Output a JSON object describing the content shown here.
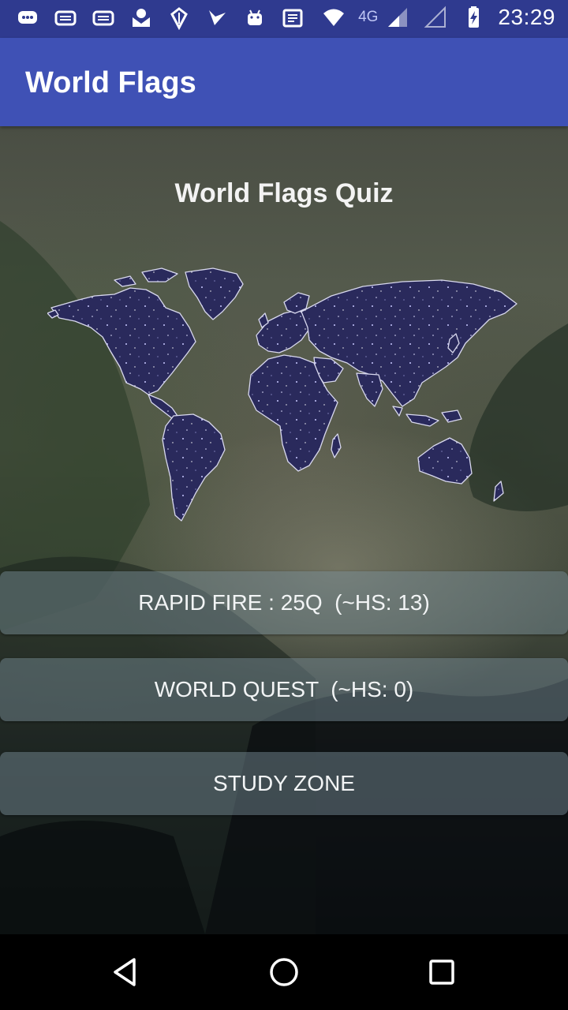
{
  "status_bar": {
    "left_icons": [
      "chat-icon",
      "mail-icon",
      "mail-icon",
      "envelope-icon",
      "game-icon",
      "checkmark-app-icon",
      "android-icon",
      "news-icon"
    ],
    "network_label": "4G",
    "right_icons": [
      "wifi-icon",
      "signal-icon",
      "signal-icon",
      "battery-charging-icon"
    ],
    "time": "23:29"
  },
  "app_bar": {
    "title": "World Flags",
    "color": "#3f51b5"
  },
  "main": {
    "quiz_title": "World Flags Quiz",
    "map_icon": "world-map-icon",
    "buttons": {
      "rapid_fire": "RAPID FIRE : 25Q  (~HS: 13)",
      "world_quest": "WORLD QUEST  (~HS: 0)",
      "study_zone": "STUDY ZONE"
    }
  },
  "nav_bar": {
    "icons": [
      "back-icon",
      "home-icon",
      "recents-icon"
    ]
  }
}
